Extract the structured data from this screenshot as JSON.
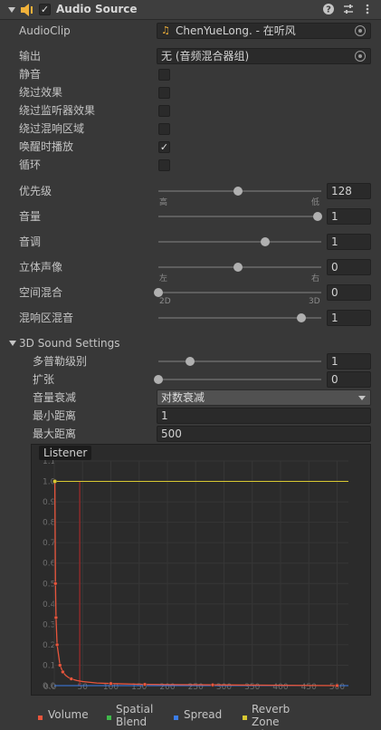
{
  "header": {
    "title": "Audio Source",
    "enabled_mark": "✓"
  },
  "props": [
    {
      "label": "AudioClip",
      "type": "object",
      "value": "ChenYueLong. - 在听风"
    },
    {
      "label": "输出",
      "type": "object",
      "value": "无 (音频混合器组)"
    },
    {
      "label": "静音",
      "type": "toggle",
      "checked": false
    },
    {
      "label": "绕过效果",
      "type": "toggle",
      "checked": false
    },
    {
      "label": "绕过监听器效果",
      "type": "toggle",
      "checked": false
    },
    {
      "label": "绕过混响区域",
      "type": "toggle",
      "checked": false
    },
    {
      "label": "唤醒时播放",
      "type": "toggle",
      "checked": true
    },
    {
      "label": "循环",
      "type": "toggle",
      "checked": false
    }
  ],
  "check_mark": "✓",
  "sliders": [
    {
      "label": "优先级",
      "value": "128",
      "fraction": 0.5,
      "left": "高",
      "right": "低"
    },
    {
      "label": "音量",
      "value": "1",
      "fraction": 1.0,
      "left": "",
      "right": ""
    },
    {
      "label": "音调",
      "value": "1",
      "fraction": 0.67,
      "left": "",
      "right": ""
    },
    {
      "label": "立体声像",
      "value": "0",
      "fraction": 0.5,
      "left": "左",
      "right": "右"
    },
    {
      "label": "空间混合",
      "value": "0",
      "fraction": 0.0,
      "left": "2D",
      "right": "3D"
    },
    {
      "label": "混响区混音",
      "value": "1",
      "fraction": 0.9,
      "left": "",
      "right": ""
    }
  ],
  "settings3d": {
    "title": "3D Sound Settings",
    "doppler": {
      "label": "多普勒级别",
      "value": "1",
      "fraction": 0.2
    },
    "spread": {
      "label": "扩张",
      "value": "0",
      "fraction": 0.0
    },
    "rolloff": {
      "label": "音量衰减",
      "value": "对数衰减"
    },
    "min_distance": {
      "label": "最小距离",
      "value": "1"
    },
    "max_distance": {
      "label": "最大距离",
      "value": "500"
    }
  },
  "chart_data": {
    "type": "line",
    "title": "Listener",
    "x_ticks": [
      "0.0",
      "50",
      "100",
      "150",
      "200",
      "250",
      "300",
      "350",
      "400",
      "450",
      "500"
    ],
    "y_ticks": [
      "0.0",
      "0.1",
      "0.2",
      "0.3",
      "0.4",
      "0.5",
      "0.6",
      "0.7",
      "0.8",
      "0.9",
      "1.0",
      "1.1"
    ],
    "xlim": [
      0,
      520
    ],
    "ylim": [
      0,
      1.1
    ],
    "listener_distance": 45,
    "series": [
      {
        "name": "Volume",
        "color": "#e8553c",
        "x": [
          1,
          2,
          3,
          5,
          10,
          15,
          20,
          25,
          30,
          40,
          50,
          75,
          100,
          150,
          200,
          280,
          500
        ],
        "y": [
          1.0,
          0.5,
          0.333,
          0.2,
          0.1,
          0.067,
          0.05,
          0.04,
          0.033,
          0.025,
          0.02,
          0.013,
          0.01,
          0.0067,
          0.005,
          0.0036,
          0.0
        ]
      },
      {
        "name": "Spatial Blend",
        "color": "#3fb94a",
        "x": [
          0,
          520
        ],
        "y": [
          0,
          0
        ]
      },
      {
        "name": "Spread",
        "color": "#3b7de8",
        "x": [
          0,
          520
        ],
        "y": [
          0,
          0
        ]
      },
      {
        "name": "Reverb Zone Mix",
        "color": "#d8c832",
        "x": [
          0,
          520
        ],
        "y": [
          1.0,
          1.0
        ]
      }
    ],
    "markers": [
      {
        "x": 1,
        "y": 1.0
      },
      {
        "x": 2,
        "y": 0.5
      },
      {
        "x": 3,
        "y": 0.333
      },
      {
        "x": 5,
        "y": 0.2
      },
      {
        "x": 10,
        "y": 0.1
      },
      {
        "x": 15,
        "y": 0.067
      },
      {
        "x": 30,
        "y": 0.033
      },
      {
        "x": 100,
        "y": 0.01
      },
      {
        "x": 160,
        "y": 0.006
      },
      {
        "x": 280,
        "y": 0.0036
      },
      {
        "x": 500,
        "y": 0.0
      }
    ],
    "legend": [
      {
        "name": "Volume",
        "color": "#e8553c",
        "line1": "Volume",
        "line2": ""
      },
      {
        "name": "Spatial Blend",
        "color": "#3fb94a",
        "line1": "Spatial",
        "line2": "Blend"
      },
      {
        "name": "Spread",
        "color": "#3b7de8",
        "line1": "Spread",
        "line2": ""
      },
      {
        "name": "Reverb Zone Mix",
        "color": "#d8c832",
        "line1": "Reverb",
        "line2": "Zone Mix"
      }
    ]
  }
}
